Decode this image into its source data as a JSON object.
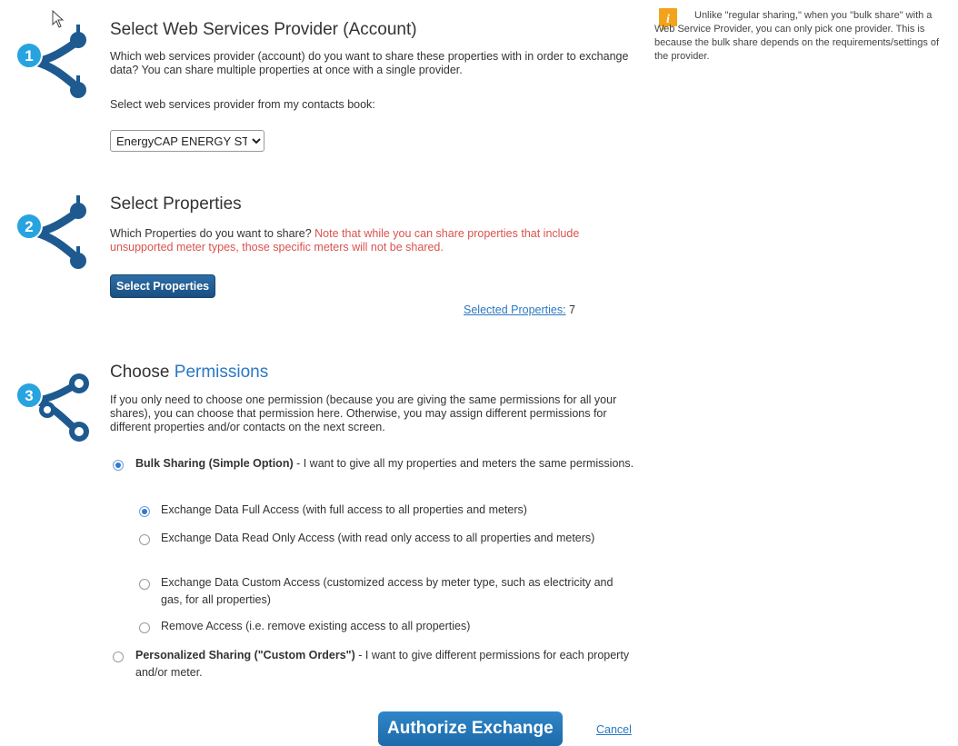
{
  "step1": {
    "number": "1",
    "title": "Select Web Services Provider (Account)",
    "description": "Which web services provider (account) do you want to share these properties with in order to exchange data? You can share multiple properties at once with a single provider.",
    "select_label": "Select web services provider from my contacts book:",
    "provider_selected": "EnergyCAP ENERGY STAR Admin (GS"
  },
  "info": {
    "text": "Unlike \"regular sharing,\" when you \"bulk share\" with a Web Service Provider, you can only pick one provider. This is because the bulk share depends on the requirements/settings of the provider."
  },
  "step2": {
    "number": "2",
    "title": "Select Properties",
    "description": "Which Properties do you want to share?",
    "note": "Note that while you can share properties that include unsupported meter types, those specific meters will not be shared.",
    "button_label": "Select Properties",
    "selected_link": "Selected Properties:",
    "selected_count": "7"
  },
  "step3": {
    "number": "3",
    "title_prefix": "Choose",
    "title_link": "Permissions",
    "description": "If you only need to choose one permission (because you are giving the same permissions for all your shares), you can choose that permission here. Otherwise, you may assign different permissions for different properties and/or contacts on the next screen.",
    "bulk": {
      "label_bold": "Bulk Sharing (Simple Option)",
      "label_rest": " - I want to give all my properties and meters the same permissions."
    },
    "options": [
      {
        "label": "Exchange Data Full Access (with full access to all properties and meters)",
        "selected": true
      },
      {
        "label": "Exchange Data Read Only Access (with read only access to all properties and meters)",
        "selected": false
      },
      {
        "label": "Exchange Data Custom Access (customized access by meter type, such as electricity and gas, for all properties)",
        "selected": false
      },
      {
        "label": "Remove Access (i.e. remove existing access to all properties)",
        "selected": false
      }
    ],
    "personal": {
      "label_bold": "Personalized Sharing (\"Custom Orders\")",
      "label_rest": " - I want to give different permissions for each property and/or meter."
    }
  },
  "footer": {
    "authorize_label": "Authorize Exchange",
    "cancel_label": "Cancel"
  },
  "colors": {
    "step_blue": "#1e5a8f",
    "circle_blue": "#27a4e0",
    "accent_link": "#2a78c2",
    "note_red": "#d9534f",
    "info_orange": "#f2a31b"
  }
}
